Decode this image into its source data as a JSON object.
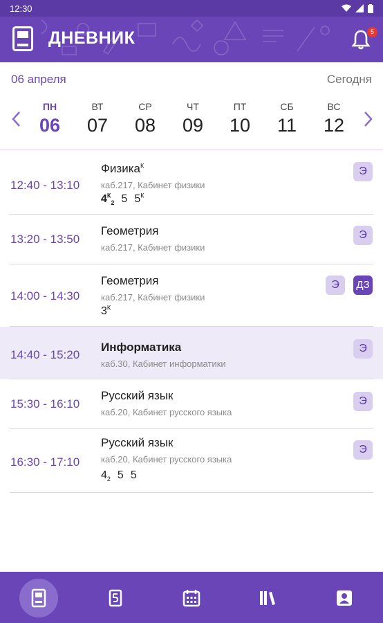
{
  "status": {
    "time": "12:30"
  },
  "appbar": {
    "title": "ДНЕВНИК",
    "notifications": "5"
  },
  "datebar": {
    "date": "06 апреля",
    "today": "Сегодня"
  },
  "week": [
    {
      "wd": "ПН",
      "num": "06",
      "active": true
    },
    {
      "wd": "ВТ",
      "num": "07"
    },
    {
      "wd": "СР",
      "num": "08"
    },
    {
      "wd": "ЧТ",
      "num": "09"
    },
    {
      "wd": "ПТ",
      "num": "10"
    },
    {
      "wd": "СБ",
      "num": "11"
    },
    {
      "wd": "ВС",
      "num": "12"
    }
  ],
  "lessons": [
    {
      "time": "12:40 - 13:10",
      "subject": "Физика",
      "subject_mark": "К",
      "room": "каб.217, Кабинет физики",
      "grades": [
        {
          "v": "4",
          "sup": "К",
          "sub": "2",
          "bold": true
        },
        {
          "v": "5"
        },
        {
          "v": "5",
          "sup": "К"
        }
      ],
      "tags": [
        "Э"
      ]
    },
    {
      "time": "13:20 - 13:50",
      "subject": "Геометрия",
      "room": "каб.217, Кабинет физики",
      "grades": [],
      "tags": [
        "Э"
      ]
    },
    {
      "time": "14:00 - 14:30",
      "subject": "Геометрия",
      "room": "каб.217, Кабинет физики",
      "grades": [
        {
          "v": "3",
          "sup": "К"
        }
      ],
      "tags": [
        "Э",
        "ДЗ"
      ]
    },
    {
      "time": "14:40 - 15:20",
      "subject": "Информатика",
      "subject_bold": true,
      "room": "каб.30, Кабинет информатики",
      "grades": [],
      "tags": [
        "Э"
      ],
      "active": true
    },
    {
      "time": "15:30 - 16:10",
      "subject": "Русский язык",
      "room": "каб.20, Кабинет русского языка",
      "grades": [],
      "tags": [
        "Э"
      ]
    },
    {
      "time": "16:30 - 17:10",
      "subject": "Русский язык",
      "room": "каб.20, Кабинет русского языка",
      "grades": [
        {
          "v": "4",
          "sub": "2"
        },
        {
          "v": "5"
        },
        {
          "v": "5"
        }
      ],
      "tags": [
        "Э"
      ]
    }
  ],
  "nav": [
    "diary-icon",
    "marks-icon",
    "schedule-icon",
    "library-icon",
    "profile-icon"
  ],
  "colors": {
    "primary": "#6a45b8",
    "accent_bg": "#efeaf8",
    "tag_bg": "#d9cdf0",
    "badge": "#e53935"
  }
}
